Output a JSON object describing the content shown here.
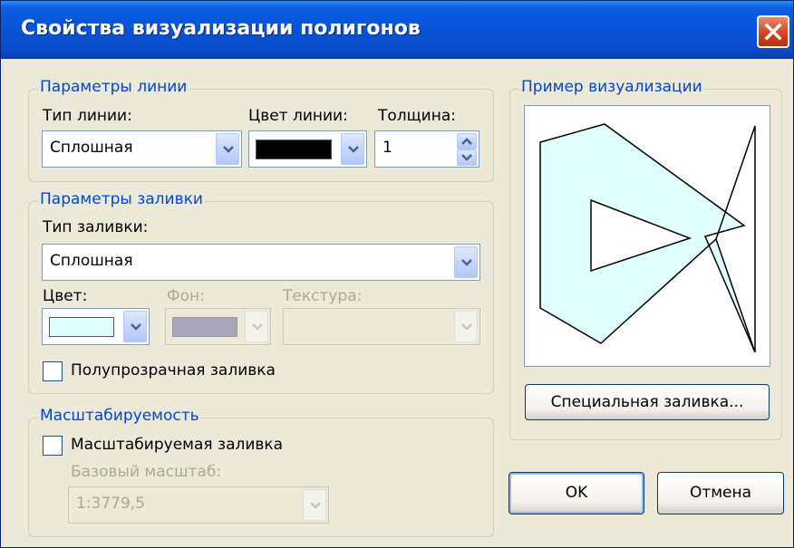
{
  "window": {
    "title": "Свойства визуализации полигонов"
  },
  "line_params": {
    "legend": "Параметры линии",
    "type_label": "Тип линии:",
    "type_value": "Сплошная",
    "color_label": "Цвет линии:",
    "color_value": "#000000",
    "width_label": "Толщина:",
    "width_value": "1"
  },
  "fill_params": {
    "legend": "Параметры заливки",
    "type_label": "Тип заливки:",
    "type_value": "Сплошная",
    "color_label": "Цвет:",
    "color_value": "#e0ffff",
    "bg_label": "Фон:",
    "bg_value": "#a8a5b8",
    "texture_label": "Текстура:",
    "translucent_label": "Полупрозрачная заливка",
    "translucent_checked": false
  },
  "scaling": {
    "legend": "Масштабируемость",
    "scalable_label": "Масштабируемая заливка",
    "scalable_checked": false,
    "base_scale_label": "Базовый масштаб:",
    "base_scale_value": "1:3779,5"
  },
  "preview": {
    "legend": "Пример визуализации",
    "special_fill_button": "Специальная заливка...",
    "fill_color": "#e0ffff",
    "line_color": "#000000"
  },
  "buttons": {
    "ok": "OK",
    "cancel": "Отмена"
  }
}
